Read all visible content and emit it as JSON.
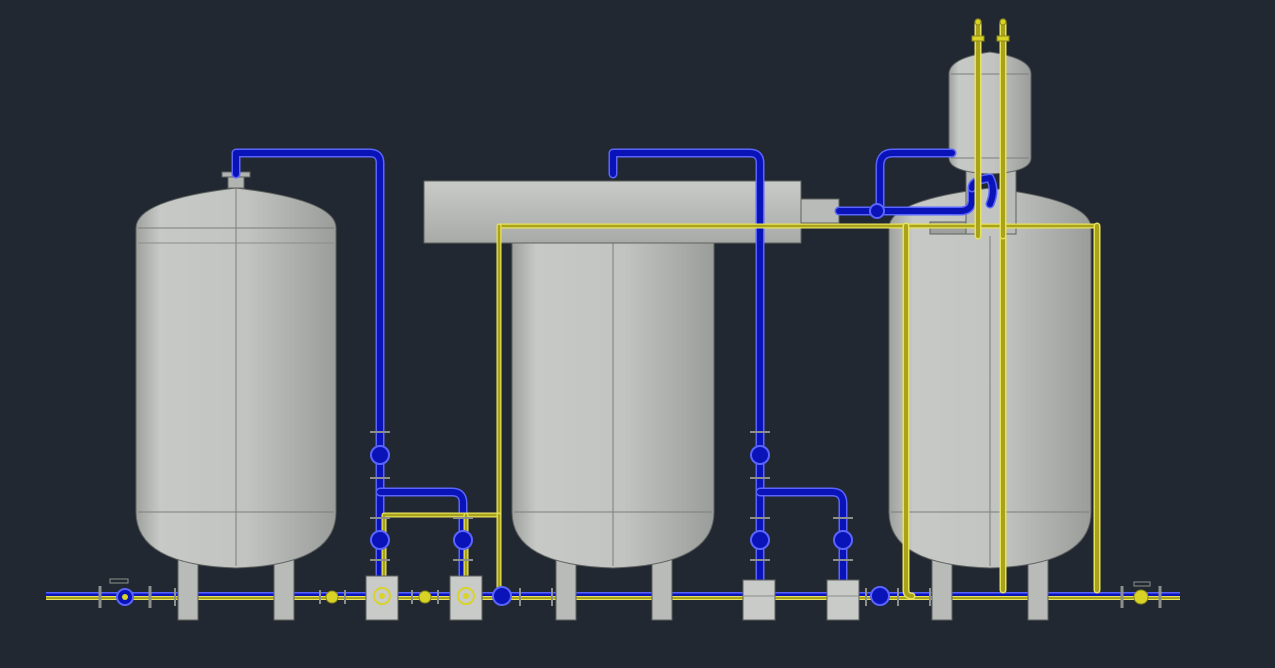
{
  "viewport": {
    "background": "#212831"
  },
  "palette": {
    "vessel_fill": "#c4c6c4",
    "vessel_shade": "#9ea09e",
    "vessel_edge": "#5f6260",
    "blue_pipe": "#0a13b8",
    "blue_pipe_edge": "#5a64ff",
    "yellow_pipe": "#a9a31c",
    "yellow_pipe_edge": "#e8e25a",
    "valve_handle": "#d9d327",
    "flange": "#8d8f8d"
  },
  "components": {
    "tanks": [
      {
        "id": "tank-1",
        "type": "vertical-vessel"
      },
      {
        "id": "tank-2",
        "type": "vertical-vessel"
      },
      {
        "id": "tank-3",
        "type": "vertical-vessel"
      }
    ],
    "upper_vessel": {
      "id": "receiver-tank",
      "type": "vertical-vessel"
    },
    "header": {
      "id": "horizontal-header",
      "type": "horizontal-vessel"
    },
    "pumps": [
      "pump-1",
      "pump-2",
      "pump-3",
      "pump-4"
    ],
    "lines": [
      "blue-process-line",
      "yellow-service-line"
    ]
  }
}
